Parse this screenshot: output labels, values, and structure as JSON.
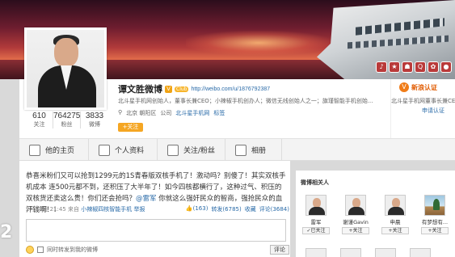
{
  "banner": {
    "icons": [
      "♪",
      "★",
      "☗",
      "Q",
      "✿",
      "●"
    ]
  },
  "profile": {
    "name": "谭文胜微博",
    "vip": "V",
    "club_badge": "Club",
    "url": "http://weibo.com/u/1876792387",
    "bio": "北斗星手机网创始人，董事长兼CEO；小辣椒手机创办人；微信无线创始人之一；旗瑾智能手机创始...",
    "location_icon": "location-pin-icon",
    "location": "北京 朝阳区",
    "company_prefix": "公司",
    "company": "北斗星手机网",
    "tags": "标签",
    "follow_label": "+关注",
    "stats": [
      {
        "num": "610",
        "label": "关注"
      },
      {
        "num": "764275",
        "label": "粉丝"
      },
      {
        "num": "3833",
        "label": "微博"
      }
    ],
    "verify": {
      "label": "新浪认证",
      "desc": "北斗星手机网董事长兼CEO",
      "apply": "申请认证"
    }
  },
  "nav": {
    "items": [
      {
        "label": "他的主页",
        "icon": "home-icon"
      },
      {
        "label": "个人资料",
        "icon": "person-icon"
      },
      {
        "label": "关注/粉丝",
        "icon": "people-icon"
      },
      {
        "label": "相册",
        "icon": "camera-icon"
      }
    ]
  },
  "post": {
    "text_before": "恭喜米粉们又可以抢到1299元的1S青春版双核手机了！激动吗？别傻了！其实双核手机成本 连500元都不到，还积压了大半年了！如今四核都横行了，这种过气、积压的双核货还卖这么贵！你们还会抢吗？",
    "mention": "@雷军",
    "text_after": " 你就这么强奸民众的智商，强抢民众的血汗钱啊！！",
    "time": "2月21日 21:45",
    "source_prefix": "来自",
    "source": "小辣椒四核智能手机",
    "report": "举报",
    "likes": "(163)",
    "reposts": "转发(6785)",
    "favorite": "收藏",
    "comments": "评论(3684)",
    "sync_label": "同时转发到我的微博",
    "comment_button": "评论"
  },
  "watermark": "2",
  "side": {
    "title": "微博相关人",
    "friends": [
      {
        "name": "雷军",
        "button": "✓已关注"
      },
      {
        "name": "谢谨Gavin",
        "button": "+关注"
      },
      {
        "name": "申晨",
        "button": "+关注"
      },
      {
        "name": "有梦想有...",
        "button": "+关注"
      }
    ]
  }
}
